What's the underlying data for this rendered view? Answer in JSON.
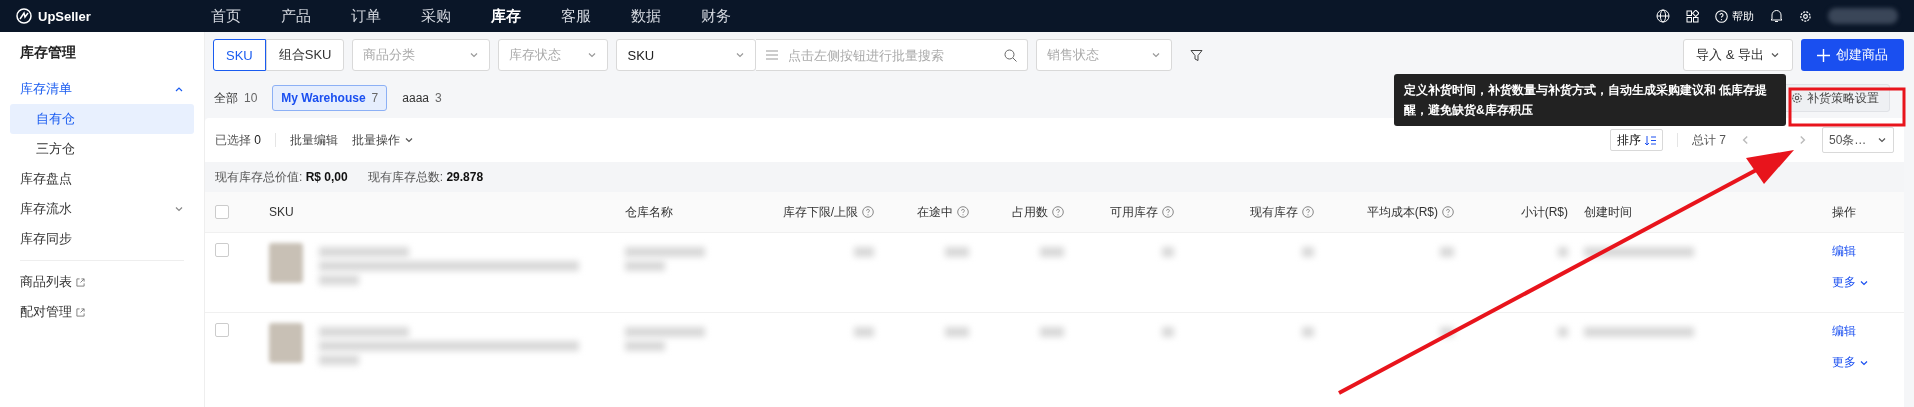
{
  "nav": {
    "logo": "UpSeller",
    "menu": [
      {
        "label": "首页",
        "selected": false
      },
      {
        "label": "产品",
        "selected": false
      },
      {
        "label": "订单",
        "selected": false
      },
      {
        "label": "采购",
        "selected": false
      },
      {
        "label": "库存",
        "selected": true
      },
      {
        "label": "客服",
        "selected": false
      },
      {
        "label": "数据",
        "selected": false
      },
      {
        "label": "财务",
        "selected": false
      }
    ],
    "help": "帮助"
  },
  "sidebar": {
    "title": "库存管理",
    "items": [
      {
        "label": "库存清单",
        "kind": "group",
        "expanded": true,
        "selected": true,
        "children": [
          {
            "label": "自有仓",
            "selected": true
          },
          {
            "label": "三方仓",
            "selected": false
          }
        ]
      },
      {
        "label": "库存盘点",
        "kind": "link",
        "selected": false
      },
      {
        "label": "库存流水",
        "kind": "group",
        "expanded": false,
        "selected": false
      },
      {
        "label": "库存同步",
        "kind": "link",
        "selected": false
      },
      {
        "label": "商品列表",
        "kind": "external",
        "selected": false
      },
      {
        "label": "配对管理",
        "kind": "external",
        "selected": false
      }
    ]
  },
  "filters": {
    "sku_type": [
      {
        "label": "SKU",
        "selected": true
      },
      {
        "label": "组合SKU",
        "selected": false
      }
    ],
    "category": {
      "placeholder": "商品分类"
    },
    "stock_status": {
      "placeholder": "库存状态"
    },
    "search_by": {
      "value": "SKU"
    },
    "search": {
      "placeholder": "点击左侧按钮进行批量搜索"
    },
    "sales_status": {
      "placeholder": "销售状态"
    },
    "import_export": "导入 & 导出",
    "create": "创建商品"
  },
  "warehouse_tabs": [
    {
      "label": "全部",
      "count": "10",
      "selected": false
    },
    {
      "label": "My Warehouse",
      "count": "7",
      "selected": true
    },
    {
      "label": "aaaa",
      "count": "3",
      "selected": false
    }
  ],
  "strategy_button": "补货策略设置",
  "tooltip": "定义补货时间，补货数量与补货方式，自动生成采购建议和 低库存提醒，避免缺货&库存积压",
  "toolbar": {
    "selected_label": "已选择",
    "selected_count": "0",
    "bulk_edit": "批量编辑",
    "bulk_actions": "批量操作",
    "sort": "排序",
    "total": "总计 7",
    "page_size": "50条…"
  },
  "summary": [
    {
      "label": "现有库存总价值:",
      "value": "R$ 0,00"
    },
    {
      "label": "现有库存总数:",
      "value": "29.878"
    }
  ],
  "table": {
    "select_all_checked": false,
    "columns": [
      {
        "label": "SKU",
        "help": false
      },
      {
        "label": "仓库名称",
        "help": false
      },
      {
        "label": "库存下限/上限",
        "help": true
      },
      {
        "label": "在途中",
        "help": true
      },
      {
        "label": "占用数",
        "help": true
      },
      {
        "label": "可用库存",
        "help": true
      },
      {
        "label": "现有库存",
        "help": true
      },
      {
        "label": "平均成本(R$)",
        "help": true
      },
      {
        "label": "小计(R$)",
        "help": false
      },
      {
        "label": "创建时间",
        "help": false
      },
      {
        "label": "操作",
        "help": false
      }
    ],
    "rows": [
      {
        "checked": false,
        "actions": [
          "编辑",
          "更多"
        ]
      },
      {
        "checked": false,
        "actions": [
          "编辑",
          "更多"
        ]
      }
    ]
  }
}
